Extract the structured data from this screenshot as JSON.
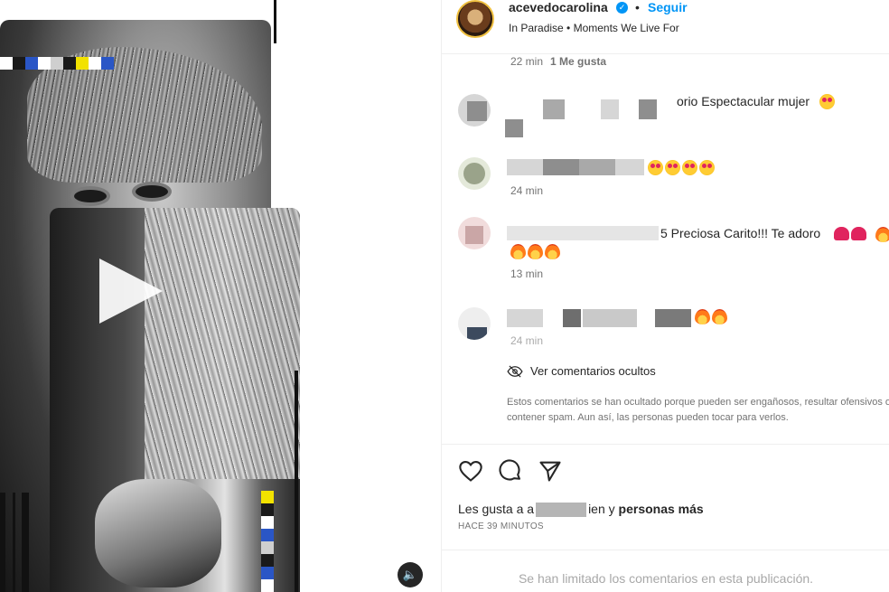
{
  "header": {
    "username": "acevedocarolina",
    "follow_label": "Seguir",
    "separator": "•",
    "subtitle": "In Paradise • Moments We Live For"
  },
  "top_meta": {
    "time": "22 min",
    "likes": "1 Me gusta"
  },
  "comments": [
    {
      "text_visible": "orio Espectacular mujer",
      "emoji": [
        "heart-eyes"
      ],
      "time": ""
    },
    {
      "text_visible": "",
      "emoji": [
        "heart-eyes",
        "heart-eyes",
        "heart-eyes",
        "heart-eyes"
      ],
      "time": "24 min"
    },
    {
      "text_visible": "5 Preciosa Carito!!! Te adoro",
      "emoji": [
        "heart",
        "heart",
        "fire",
        "fire",
        "fire",
        "fire"
      ],
      "time": "13 min"
    },
    {
      "text_visible": "",
      "emoji": [
        "fire",
        "fire"
      ],
      "time": "24 min"
    }
  ],
  "hidden_comments": {
    "link_label": "Ver comentarios ocultos",
    "note": "Estos comentarios se han ocultado porque pueden ser engañosos, resultar ofensivos o contener spam. Aun así, las personas pueden tocar para verlos."
  },
  "likes": {
    "prefix": "Les gusta a a",
    "suffix": "ien y",
    "bold": "personas más"
  },
  "post_time": "HACE 39 MINUTOS",
  "comments_limited": "Se han limitado los comentarios en esta publicación.",
  "colors": {
    "link_blue": "#0095f6",
    "text": "#262626",
    "muted": "#737373"
  },
  "media": {
    "pixel_top": [
      "#ffffff",
      "#1a1a1a",
      "#2a56c6",
      "#ffffff",
      "#cfcfcf",
      "#1a1a1a",
      "#f2e200",
      "#ffffff",
      "#2a56c6"
    ],
    "pixel_right": [
      "#f2e200",
      "#1a1a1a",
      "#ffffff",
      "#2a56c6",
      "#cfcfcf",
      "#1a1a1a",
      "#2a56c6",
      "#ffffff",
      "#cfcfcf"
    ]
  }
}
